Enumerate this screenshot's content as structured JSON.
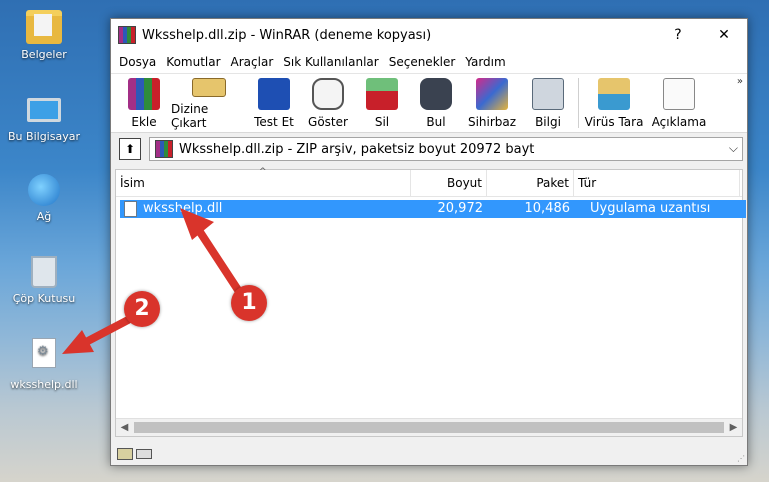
{
  "desktop": {
    "icons": [
      {
        "label": "Belgeler",
        "icon": "documents-folder-icon"
      },
      {
        "label": "Bu Bilgisayar",
        "icon": "this-pc-icon"
      },
      {
        "label": "Ağ",
        "icon": "network-icon"
      },
      {
        "label": "Çöp Kutusu",
        "icon": "recycle-bin-icon"
      },
      {
        "label": "wksshelp.dll",
        "icon": "dll-file-icon"
      }
    ]
  },
  "window": {
    "title": "Wksshelp.dll.zip - WinRAR (deneme kopyası)",
    "help_button": "?",
    "close_button": "✕",
    "menu": [
      "Dosya",
      "Komutlar",
      "Araçlar",
      "Sık Kullanılanlar",
      "Seçenekler",
      "Yardım"
    ],
    "toolbar": [
      {
        "label": "Ekle",
        "icon": "add-archive-icon",
        "color": "#6b3aa0"
      },
      {
        "label": "Dizine Çıkart",
        "icon": "extract-to-icon",
        "color": "#c79a3a"
      },
      {
        "label": "Test Et",
        "icon": "test-icon",
        "color": "#1e4fb3"
      },
      {
        "label": "Göster",
        "icon": "view-icon",
        "color": "#8a8a8a"
      },
      {
        "label": "Sil",
        "icon": "delete-icon",
        "color": "#3a8a5a"
      },
      {
        "label": "Bul",
        "icon": "find-icon",
        "color": "#444c5a"
      },
      {
        "label": "Sihirbaz",
        "icon": "wizard-icon",
        "color": "#8a3a8a"
      },
      {
        "label": "Bilgi",
        "icon": "info-icon",
        "color": "#4a7ac9"
      },
      {
        "label": "Virüs Tara",
        "icon": "virus-scan-icon",
        "color": "#3a9ad0"
      },
      {
        "label": "Açıklama",
        "icon": "comment-icon",
        "color": "#d0a050"
      }
    ],
    "toolbar_more": "»",
    "address": {
      "up_button": "⬆",
      "path": "Wksshelp.dll.zip - ZIP arşiv, paketsiz boyut 20972 bayt",
      "dropdown": "⌵"
    },
    "list": {
      "headers": {
        "name": "İsim",
        "size": "Boyut",
        "packed": "Paket",
        "type": "Tür"
      },
      "rows": [
        {
          "name": "wksshelp.dll",
          "size": "20,972",
          "packed": "10,486",
          "type": "Uygulama uzantısı"
        }
      ]
    },
    "scroll_left": "◀",
    "scroll_right": "▶"
  },
  "annotations": {
    "badge_1": "1",
    "badge_2": "2",
    "color": "#d9342b"
  }
}
